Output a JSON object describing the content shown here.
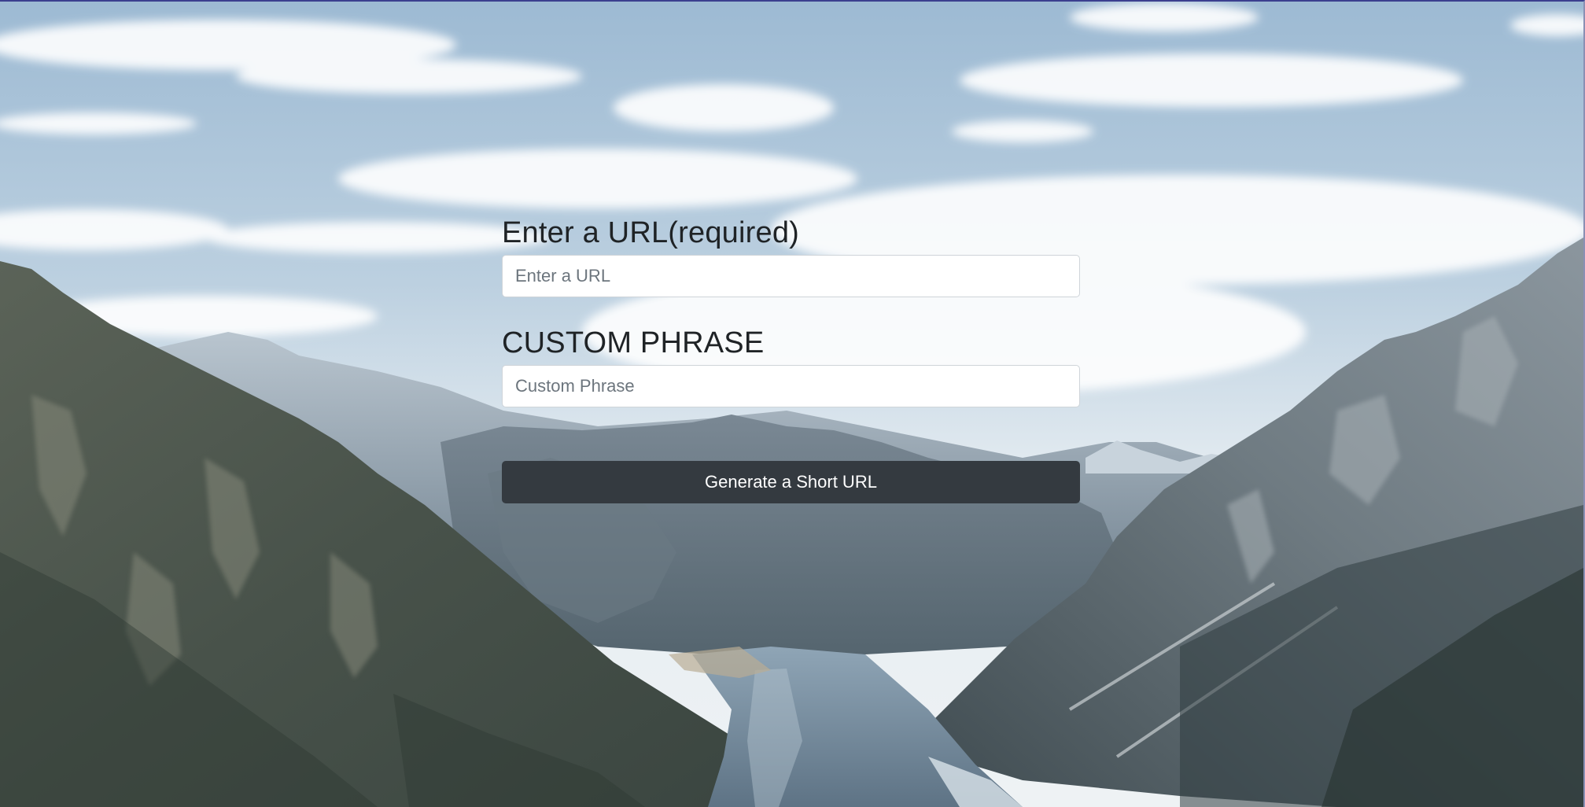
{
  "form": {
    "url_label": "Enter a URL(required)",
    "url_placeholder": "Enter a URL",
    "url_value": "",
    "custom_label": "CUSTOM PHRASE",
    "custom_placeholder": "Custom Phrase",
    "custom_value": "",
    "submit_label": "Generate a Short URL"
  },
  "colors": {
    "button_bg": "#343a40",
    "button_text": "#ffffff",
    "label_text": "#1f2326",
    "input_border": "#cfd4d9"
  }
}
